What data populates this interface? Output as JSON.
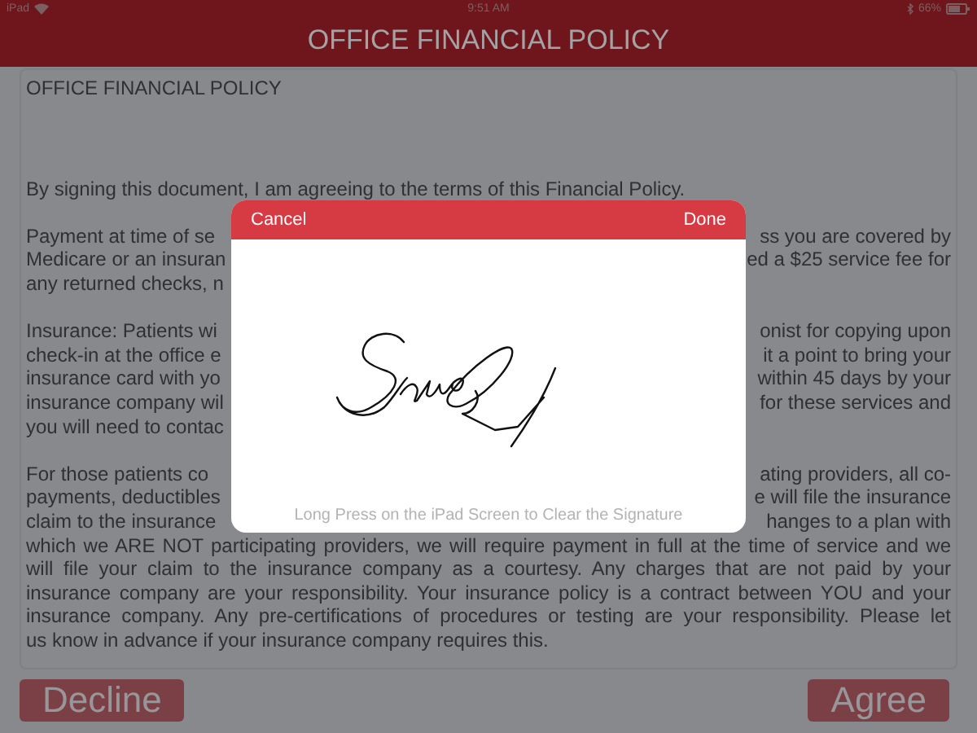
{
  "status_bar": {
    "device": "iPad",
    "time": "9:51 AM",
    "battery": "66%"
  },
  "header": {
    "title": "OFFICE FINANCIAL POLICY"
  },
  "document": {
    "title": "OFFICE FINANCIAL POLICY",
    "paragraphs": [
      {
        "lines": [
          {
            "kind": "plain",
            "left": "By signing this document, I am agreeing to the terms of this Financial Policy."
          }
        ]
      },
      {
        "lines": [
          {
            "kind": "split",
            "left": "Payment at time of se",
            "right": "ss you are covered by"
          },
          {
            "kind": "split",
            "left": "Medicare or an insuran",
            "right": "ed a $25 service fee for"
          },
          {
            "kind": "split",
            "left": "any returned checks, n"
          }
        ]
      },
      {
        "lines": [
          {
            "kind": "split",
            "left": "Insurance:  Patients wi",
            "right": "onist for copying upon"
          },
          {
            "kind": "split",
            "left": "check-in at the office e",
            "right": "it a point to bring your"
          },
          {
            "kind": "split",
            "left": "insurance card with yo",
            "right": "within 45 days by your"
          },
          {
            "kind": "split",
            "left": "insurance company wil",
            "right": "for these services and"
          },
          {
            "kind": "split",
            "left": "you will need to contac"
          }
        ]
      },
      {
        "lines": [
          {
            "kind": "split",
            "left": "For those patients co",
            "right": "ating providers, all co-"
          },
          {
            "kind": "split",
            "left": "payments, deductibles",
            "right": "e will file the insurance"
          },
          {
            "kind": "split",
            "left": "claim to the insurance",
            "right": "hanges to a plan with"
          },
          {
            "kind": "full",
            "left": "which we ARE NOT participating providers, we will require payment in full at the time of service and we"
          },
          {
            "kind": "full",
            "left": "will file your claim to the insurance company as a courtesy. Any charges that are not paid by your"
          },
          {
            "kind": "full",
            "left": "insurance company are your responsibility. Your insurance policy is a contract between YOU and your"
          },
          {
            "kind": "full",
            "left": "insurance company.  Any pre-certifications of procedures or testing are your responsibility.  Please let"
          },
          {
            "kind": "plain",
            "left": "us know in advance if your insurance company requires this."
          }
        ]
      }
    ]
  },
  "signature_dialog": {
    "cancel": "Cancel",
    "done": "Done",
    "hint": "Long Press on the iPad Screen to Clear the Signature"
  },
  "buttons": {
    "decline": "Decline",
    "agree": "Agree"
  }
}
